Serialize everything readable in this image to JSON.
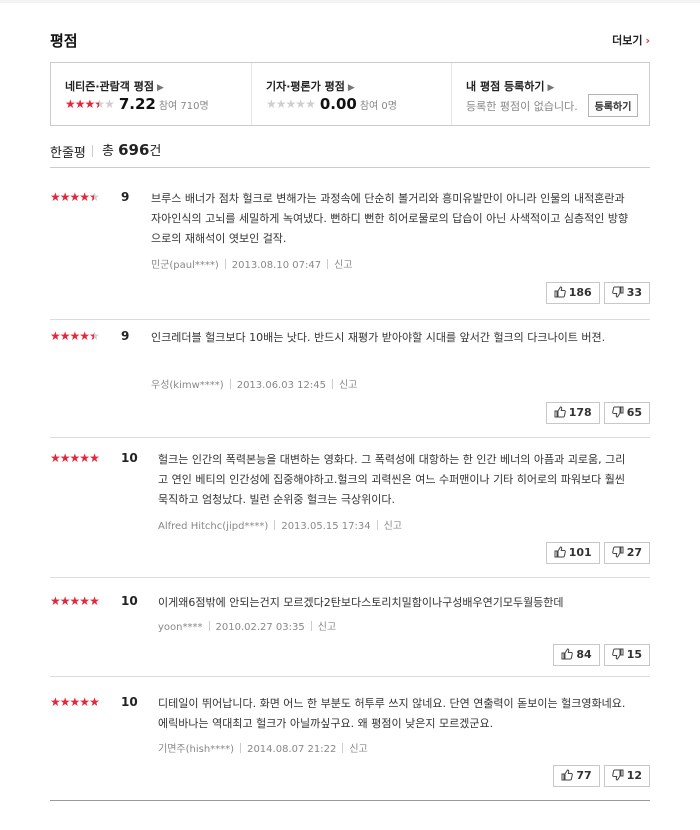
{
  "header": {
    "title": "평점",
    "more_label": "더보기"
  },
  "summary": {
    "netizen": {
      "title": "네티즌·관람객 평점",
      "score": "7.22",
      "count": "참여 710명",
      "stars": 3.5
    },
    "critic": {
      "title": "기자·평론가 평점",
      "score": "0.00",
      "count": "참여 0명",
      "stars": 0
    },
    "mine": {
      "title": "내 평점 등록하기",
      "text": "등록한 평점이 없습니다.",
      "button": "등록하기"
    }
  },
  "list_header": {
    "label": "한줄평",
    "total_prefix": "총 ",
    "total_num": "696",
    "total_suffix": "건"
  },
  "reviews": [
    {
      "stars": 4.5,
      "score": "9",
      "text": "브루스 배너가 점차 헐크로 변해가는 과정속에 단순히 볼거리와 흥미유발만이 아니라 인물의 내적혼란과 자아인식의 고뇌를 세밀하게 녹여냈다. 뻔하디 뻔한 히어로물로의 답습이 아닌 사색적이고 심층적인 방향으로의 재해석이 엿보인 걸작.",
      "author": "민군(paul****)",
      "date": "2013.08.10 07:47",
      "report": "신고",
      "likes": "186",
      "dislikes": "33"
    },
    {
      "stars": 4.5,
      "score": "9",
      "text": "인크레더블 헐크보다 10배는 낫다. 반드시 재평가 받아야할 시대를 앞서간 헐크의 다크나이트 버젼.",
      "author": "우성(kimw****)",
      "date": "2013.06.03 12:45",
      "report": "신고",
      "likes": "178",
      "dislikes": "65"
    },
    {
      "stars": 5,
      "score": "10",
      "text": "헐크는 인간의 폭력본능을 대변하는 영화다. 그 폭력성에 대항하는 한 인간 베너의 아픔과 괴로움, 그리고 연인 베티의 인간성에 집중해야하고.헐크의 괴력씬은 여느 수퍼맨이나 기타 히어로의 파워보다 훨씬 묵직하고 엄청났다. 빌런 순위중 헐크는 극상위이다.",
      "author": "Alfred Hitchc(jipd****)",
      "date": "2013.05.15 17:34",
      "report": "신고",
      "likes": "101",
      "dislikes": "27"
    },
    {
      "stars": 5,
      "score": "10",
      "text": "이게왜6점밖에 안되는건지 모르겠다2탄보다스토리치밀함이나구성배우연기모두월등한데",
      "author": "yoon****",
      "date": "2010.02.27 03:35",
      "report": "신고",
      "likes": "84",
      "dislikes": "15"
    },
    {
      "stars": 5,
      "score": "10",
      "text": "디테일이 뛰어납니다. 화면 어느 한 부분도 허투루 쓰지 않네요. 단연 연출력이 돋보이는 헐크영화네요. 에릭바나는 역대최고 헐크가 아닐까싶구요. 왜 평점이 낮은지 모르겠군요.",
      "author": "기면주(hish****)",
      "date": "2014.08.07 21:22",
      "report": "신고",
      "likes": "77",
      "dislikes": "12"
    }
  ]
}
